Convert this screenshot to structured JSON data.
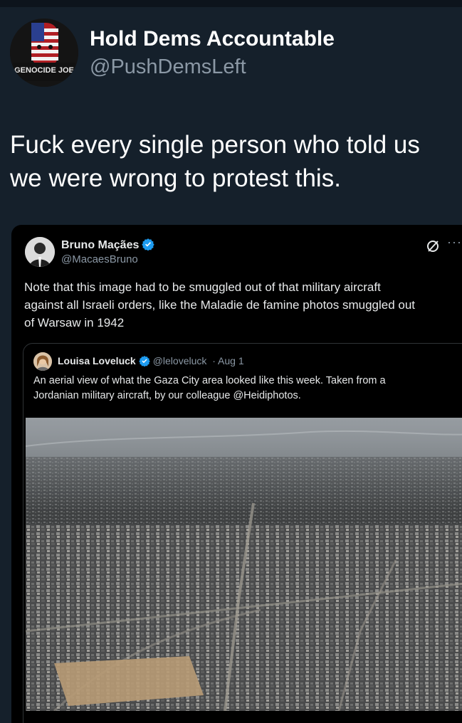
{
  "post": {
    "author_name": "Hold Dems Accountable",
    "author_handle": "@PushDemsLeft",
    "avatar_caption": "GENOCIDE JOE",
    "text": "Fuck every single person who told us we were wrong to protest this."
  },
  "quote": {
    "author_name": "Bruno Maçães",
    "author_handle": "@MacaesBruno",
    "text": "Note that this image had to be smuggled out of that military aircraft\nagainst all Israeli orders, like the Maladie de famine photos smuggled out\nof Warsaw in 1942"
  },
  "inner_quote": {
    "author_name": "Louisa Loveluck",
    "author_handle": "@leloveluck",
    "date": "· Aug 1",
    "text": "An aerial view of what the Gaza City area looked like this week. Taken from a\nJordanian military aircraft, by our colleague @Heidiphotos."
  },
  "icons": {
    "verified": "verified-badge-icon",
    "grok": "grok-icon",
    "more": "more-options-icon"
  },
  "colors": {
    "background": "#15202b",
    "card": "#000000",
    "verified": "#1d9bf0",
    "secondary_text": "#8b98a5"
  }
}
